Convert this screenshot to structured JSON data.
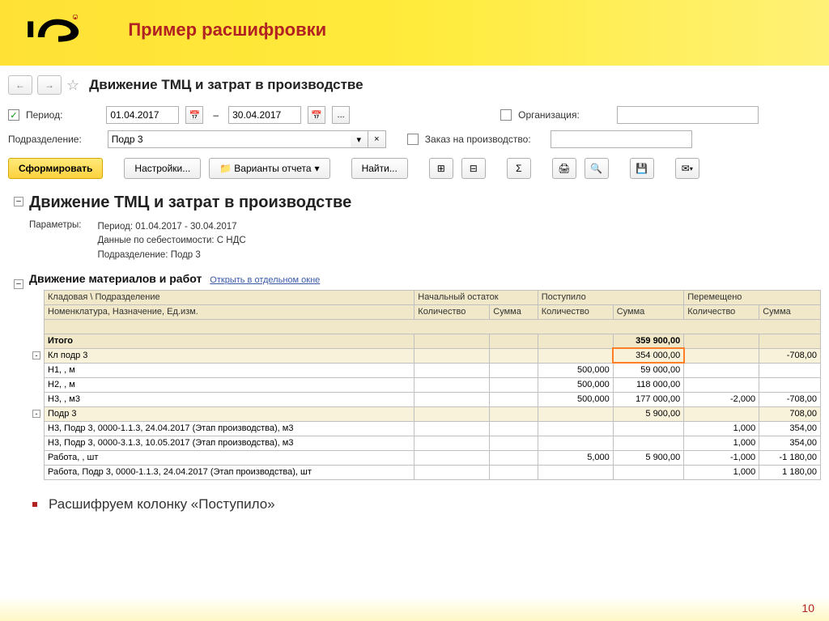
{
  "slide": {
    "title": "Пример расшифровки",
    "pageNum": "10",
    "footerText": "Расшифруем колонку «Поступило»"
  },
  "nav": {
    "pageTitle": "Движение ТМЦ и затрат в производстве"
  },
  "filters": {
    "periodLabel": "Период:",
    "dateFrom": "01.04.2017",
    "dash": "–",
    "dateTo": "30.04.2017",
    "orgLabel": "Организация:",
    "deptLabel": "Подразделение:",
    "deptValue": "Подр 3",
    "orderLabel": "Заказ на производство:"
  },
  "toolbar": {
    "form": "Сформировать",
    "settings": "Настройки...",
    "variants": "Варианты отчета",
    "find": "Найти..."
  },
  "report": {
    "title": "Движение ТМЦ и затрат в производстве",
    "paramsLabel": "Параметры:",
    "paramLine1": "Период: 01.04.2017 - 30.04.2017",
    "paramLine2": "Данные по себестоимости: С НДС",
    "paramLine3": "Подразделение: Подр 3",
    "sectionTitle": "Движение материалов и работ",
    "openLink": "Открыть в отдельном окне",
    "headers": {
      "h1": "Кладовая \\ Подразделение",
      "h2": "Начальный остаток",
      "h3": "Поступило",
      "h4": "Перемещено",
      "h1sub": "Номенклатура, Назначение, Ед.изм.",
      "qty": "Количество",
      "sum": "Сумма"
    },
    "rows": [
      {
        "name": "Итого",
        "qty1": "",
        "sum1": "",
        "qty2": "",
        "sum2": "359 900,00",
        "qty3": "",
        "sum3": "",
        "cls": "total-row"
      },
      {
        "name": "Кл подр 3",
        "qty1": "",
        "sum1": "",
        "qty2": "",
        "sum2": "354 000,00",
        "qty3": "",
        "sum3": "-708,00",
        "cls": "group-row",
        "hl": true,
        "toggle": "-"
      },
      {
        "name": "Н1, , м",
        "qty1": "",
        "sum1": "",
        "qty2": "500,000",
        "sum2": "59 000,00",
        "qty3": "",
        "sum3": ""
      },
      {
        "name": "Н2, , м",
        "qty1": "",
        "sum1": "",
        "qty2": "500,000",
        "sum2": "118 000,00",
        "qty3": "",
        "sum3": ""
      },
      {
        "name": "Н3, , м3",
        "qty1": "",
        "sum1": "",
        "qty2": "500,000",
        "sum2": "177 000,00",
        "qty3": "-2,000",
        "sum3": "-708,00"
      },
      {
        "name": "Подр 3",
        "qty1": "",
        "sum1": "",
        "qty2": "",
        "sum2": "5 900,00",
        "qty3": "",
        "sum3": "708,00",
        "cls": "group-row",
        "toggle": "-"
      },
      {
        "name": "Н3, Подр 3, 0000-1.1.3, 24.04.2017 (Этап производства), м3",
        "qty1": "",
        "sum1": "",
        "qty2": "",
        "sum2": "",
        "qty3": "1,000",
        "sum3": "354,00"
      },
      {
        "name": "Н3, Подр 3, 0000-3.1.3, 10.05.2017 (Этап производства), м3",
        "qty1": "",
        "sum1": "",
        "qty2": "",
        "sum2": "",
        "qty3": "1,000",
        "sum3": "354,00"
      },
      {
        "name": "Работа, , шт",
        "qty1": "",
        "sum1": "",
        "qty2": "5,000",
        "sum2": "5 900,00",
        "qty3": "-1,000",
        "sum3": "-1 180,00"
      },
      {
        "name": "Работа, Подр 3, 0000-1.1.3, 24.04.2017 (Этап производства), шт",
        "qty1": "",
        "sum1": "",
        "qty2": "",
        "sum2": "",
        "qty3": "1,000",
        "sum3": "1 180,00"
      }
    ]
  }
}
